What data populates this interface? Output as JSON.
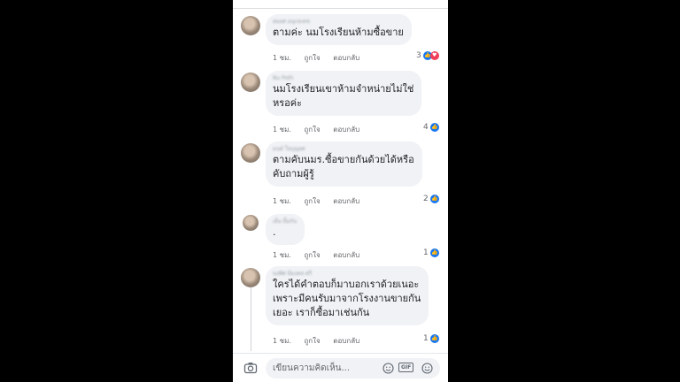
{
  "comments": [
    {
      "name": "สมยศ อนุกลเดช",
      "text_lines": [
        "ตามค่ะ นมโรงเรียนห้ามซื้อขาย"
      ],
      "time": "1 ชม.",
      "like": "ถูกใจ",
      "reply": "ตอบกลับ",
      "reactions": "3",
      "reaction_icons": [
        "like-icon",
        "love-icon"
      ]
    },
    {
      "name": "Nu Poth",
      "text_lines": [
        "นมโรงเรียนเขาห้ามจำหน่ายไม่ใช่",
        "หรอค่ะ"
      ],
      "time": "1 ชม.",
      "like": "ถูกใจ",
      "reply": "ตอบกลับ",
      "reactions": "4",
      "reaction_icons": [
        "like-icon"
      ]
    },
    {
      "name": "มนต์ ใจบุญยศ",
      "text_lines": [
        "ตามคับนมร.ซื้อขายกันด้วยได้หรือ",
        "คับถามผู้รู้"
      ],
      "time": "1 ชม.",
      "like": "ถูกใจ",
      "reply": "ตอบกลับ",
      "reactions": "2",
      "reaction_icons": [
        "like-icon"
      ]
    },
    {
      "name": "เต็ม ยิ้มกัน",
      "text_lines": [
        "."
      ],
      "time": "1 ชม.",
      "like": "ถูกใจ",
      "reply": "ตอบกลับ",
      "reactions": "1",
      "reaction_icons": [
        "like-icon"
      ]
    },
    {
      "name": "นงพิศ มีมงคล ศรี",
      "text_lines": [
        "ใครได้คำตอบก็มาบอกเราด้วยเนอะ",
        "เพราะมีคนรับมาจากโรงงานขายกัน",
        "เยอะ เราก็ซื้อมาเช่นกัน"
      ],
      "time": "1 ชม.",
      "like": "ถูกใจ",
      "reply": "ตอบกลับ",
      "reactions": "1",
      "reaction_icons": [
        "like-icon"
      ]
    }
  ],
  "composer": {
    "placeholder": "เขียนความคิดเห็น...",
    "camera_icon": "camera-icon",
    "sticker_icon": "sticker-icon",
    "gif_label": "GIF",
    "emoji_icon": "emoji-icon"
  },
  "colors": {
    "like": "#1877f2",
    "love": "#f33e58",
    "bubble": "#f0f2f5",
    "text": "#1c1e21",
    "meta": "#65676b"
  }
}
